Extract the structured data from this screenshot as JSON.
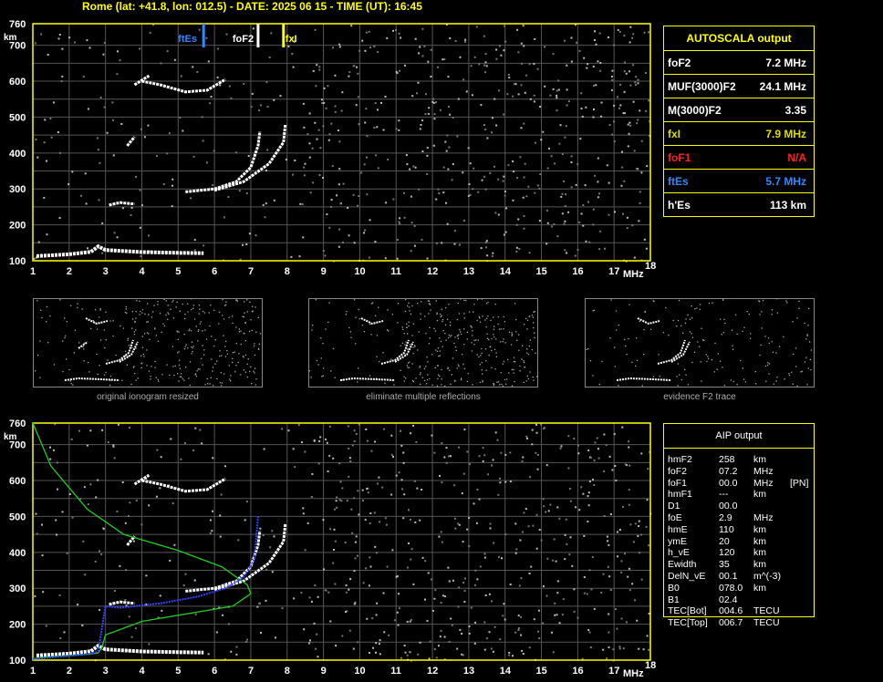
{
  "header": "Rome (lat: +41.8, lon: 012.5) - DATE: 2025 06 15 - TIME (UT): 16:45",
  "colors": {
    "frame": "#ffff00",
    "trace": "#ffffff",
    "profile": "#22cc22",
    "true_height": "#3344ff",
    "grid": "#555555"
  },
  "plots": {
    "y_unit": "km",
    "x_unit": "MHz",
    "y_ticks": [
      "760",
      "700",
      "600",
      "500",
      "400",
      "300",
      "200",
      "100"
    ],
    "x_ticks": [
      "1",
      "2",
      "3",
      "4",
      "5",
      "6",
      "7",
      "8",
      "9",
      "10",
      "11",
      "12",
      "13",
      "14",
      "15",
      "16",
      "17",
      "18"
    ],
    "markers": {
      "ftEs": "ftEs",
      "foF2": "foF2",
      "fxI": "fxI"
    }
  },
  "autoscala": {
    "title": "AUTOSCALA output",
    "rows": [
      {
        "key": "foF2",
        "value": "7.2 MHz",
        "color": "#ffffff"
      },
      {
        "key": "MUF(3000)F2",
        "value": "24.1 MHz",
        "color": "#ffffff"
      },
      {
        "key": "M(3000)F2",
        "value": "3.35",
        "color": "#ffffff"
      },
      {
        "key": "fxI",
        "value": "7.9 MHz",
        "color": "#dddd00"
      },
      {
        "key": "foF1",
        "value": "N/A",
        "color": "#ff2020"
      },
      {
        "key": "ftEs",
        "value": "5.7 MHz",
        "color": "#3388ff"
      },
      {
        "key": "h'Es",
        "value": "113    km",
        "color": "#ffffff"
      }
    ]
  },
  "thumbnails": [
    {
      "caption": "original ionogram resized"
    },
    {
      "caption": "eliminate multiple reflections"
    },
    {
      "caption": "evidence F2 trace"
    }
  ],
  "aip": {
    "title": "AIP output",
    "rows": [
      [
        "hmF2",
        "258",
        "km",
        ""
      ],
      [
        "foF2",
        "07.2",
        "MHz",
        ""
      ],
      [
        "foF1",
        "00.0",
        "MHz",
        "[PN]"
      ],
      [
        "hmF1",
        "---",
        "km",
        ""
      ],
      [
        "D1",
        "00.0",
        "",
        ""
      ],
      [
        "foE",
        "2.9",
        "MHz",
        ""
      ],
      [
        "hmE",
        "110",
        "km",
        ""
      ],
      [
        "ymE",
        "20",
        "km",
        ""
      ],
      [
        "h_vE",
        "120",
        "km",
        ""
      ],
      [
        "Ewidth",
        "35",
        "km",
        ""
      ],
      [
        "DelN_vE",
        "00.1",
        "m^(-3)",
        ""
      ],
      [
        "B0",
        "078.0",
        "km",
        ""
      ],
      [
        "B1",
        "02.4",
        "",
        ""
      ],
      [
        "TEC[Bot]",
        "004.6",
        "TECU",
        ""
      ],
      [
        "TEC[Top]",
        "006.7",
        "TECU",
        ""
      ]
    ]
  }
}
